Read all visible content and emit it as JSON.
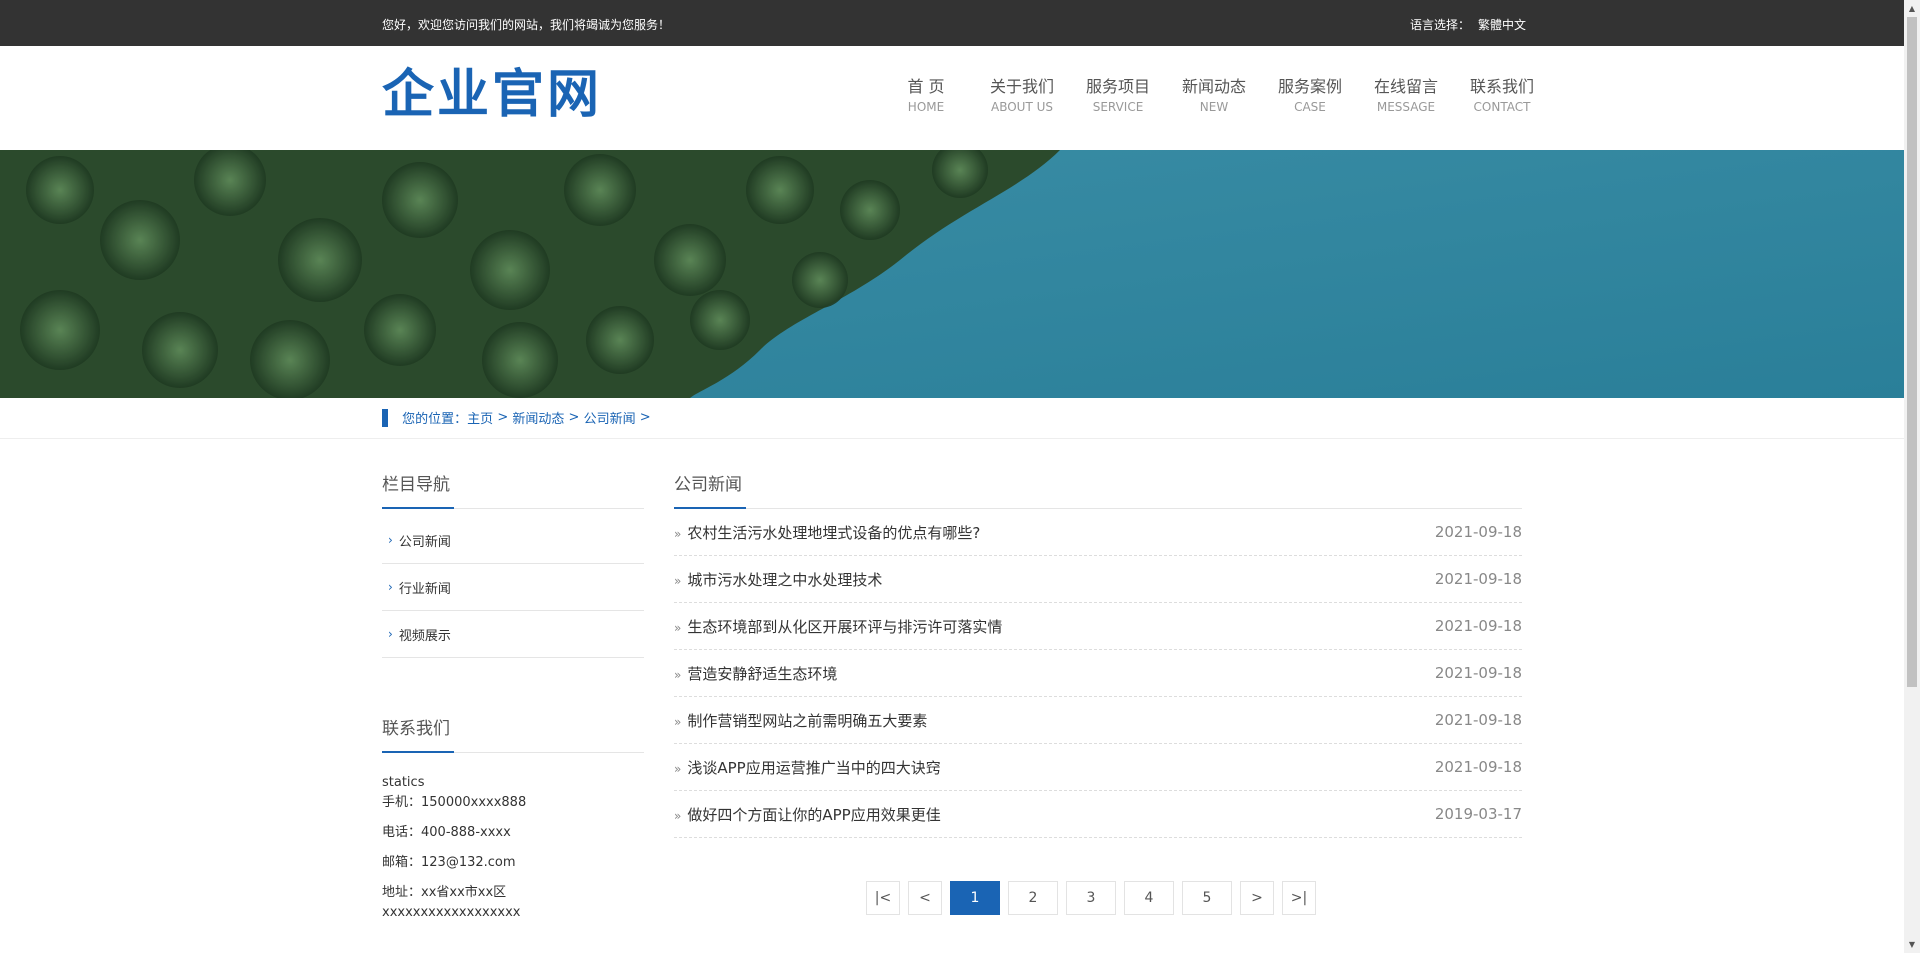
{
  "topbar": {
    "welcome": "您好，欢迎您访问我们的网站，我们将竭诚为您服务！",
    "lang_label": "语言选择：",
    "lang_link": "繁體中文"
  },
  "header": {
    "logo": "企业官网",
    "nav": [
      {
        "cn": "首 页",
        "en": "HOME"
      },
      {
        "cn": "关于我们",
        "en": "ABOUT US"
      },
      {
        "cn": "服务项目",
        "en": "SERVICE"
      },
      {
        "cn": "新闻动态",
        "en": "NEW"
      },
      {
        "cn": "服务案例",
        "en": "CASE"
      },
      {
        "cn": "在线留言",
        "en": "MESSAGE"
      },
      {
        "cn": "联系我们",
        "en": "CONTACT"
      }
    ]
  },
  "breadcrumb": {
    "prefix": "您的位置：",
    "items": [
      "主页",
      "新闻动态",
      "公司新闻"
    ],
    "sep": ">"
  },
  "sidebar": {
    "nav_title": "栏目导航",
    "items": [
      "公司新闻",
      "行业新闻",
      "视频展示"
    ],
    "contact_title": "联系我们",
    "contact": {
      "name": "statics",
      "mobile": "手机：150000xxxx888",
      "phone": "电话：400-888-xxxx",
      "email": "邮箱：123@132.com",
      "address": "地址：xx省xx市xx区xxxxxxxxxxxxxxxxxx"
    }
  },
  "main": {
    "title": "公司新闻",
    "news": [
      {
        "title": "农村生活污水处理地埋式设备的优点有哪些?",
        "date": "2021-09-18"
      },
      {
        "title": "城市污水处理之中水处理技术",
        "date": "2021-09-18"
      },
      {
        "title": "生态环境部到从化区开展环评与排污许可落实情",
        "date": "2021-09-18"
      },
      {
        "title": "营造安静舒适生态环境",
        "date": "2021-09-18"
      },
      {
        "title": "制作营销型网站之前需明确五大要素",
        "date": "2021-09-18"
      },
      {
        "title": "浅谈APP应用运营推广当中的四大诀窍",
        "date": "2021-09-18"
      },
      {
        "title": "做好四个方面让你的APP应用效果更佳",
        "date": "2019-03-17"
      }
    ]
  },
  "pagination": {
    "first": "|<",
    "prev": "<",
    "pages": [
      "1",
      "2",
      "3",
      "4",
      "5"
    ],
    "current": "1",
    "next": ">",
    "last": ">|"
  },
  "colors": {
    "accent": "#1a64b4",
    "topbar": "#333333"
  }
}
